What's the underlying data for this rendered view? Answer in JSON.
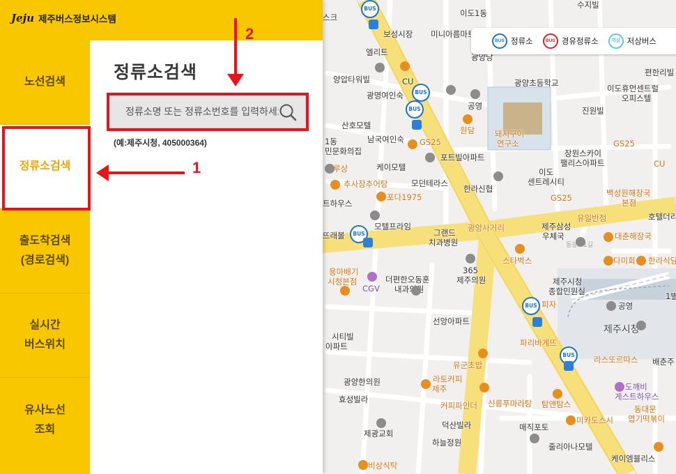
{
  "app": {
    "logo_mark": "Jeju",
    "title": "제주버스정보시스템"
  },
  "nav": {
    "items": [
      {
        "lines": [
          "노선검색"
        ]
      },
      {
        "lines": [
          "정류소검색"
        ]
      },
      {
        "lines": [
          "출도착검색",
          "(경로검색)"
        ]
      },
      {
        "lines": [
          "실시간",
          "버스위치"
        ]
      },
      {
        "lines": [
          "유사노선",
          "조회"
        ]
      }
    ]
  },
  "content": {
    "page_title": "정류소검색",
    "search_placeholder": "정류소명 또는 정류소번호를 입력하세요",
    "hint": "(예:제주시청, 405000364)"
  },
  "legend": {
    "stop": {
      "icon": "BUS",
      "label": "정류소"
    },
    "via_stop": {
      "icon": "BUS",
      "label": "경유정류소"
    },
    "lowfloor": {
      "icon": "저상",
      "label": "저상버스"
    }
  },
  "annotations": {
    "num_1": "1",
    "num_2": "2"
  },
  "map": {
    "bus_icon_text": "BUS",
    "labels": [
      {
        "id": "l1",
        "text": "이도1동",
        "cls": "big"
      },
      {
        "id": "l2",
        "text": "수지빌"
      },
      {
        "id": "l3",
        "text": "보성시장",
        "cls": "orange"
      },
      {
        "id": "l4",
        "text": "미니아름마트"
      },
      {
        "id": "l5",
        "text": "엘리트"
      },
      {
        "id": "l6",
        "text": "양압타워빌"
      },
      {
        "id": "l7",
        "text": "CU",
        "cls": "orange"
      },
      {
        "id": "l8",
        "text": "광명여인숙"
      },
      {
        "id": "l9",
        "text": "광양초등학교"
      },
      {
        "id": "l10",
        "text": "편한리빌"
      },
      {
        "id": "l11",
        "text": "이도휴먼센트럴"
      },
      {
        "id": "l12",
        "text": "오피스텔"
      },
      {
        "id": "l13",
        "text": "공영"
      },
      {
        "id": "l14",
        "text": "진원빌"
      },
      {
        "id": "l15",
        "text": "산호모텔"
      },
      {
        "id": "l16",
        "text": "원담",
        "cls": "orange"
      },
      {
        "id": "l17",
        "text": "돼지구이",
        "cls": "orange"
      },
      {
        "id": "l18",
        "text": "연구소",
        "cls": "orange"
      },
      {
        "id": "l19",
        "text": "남국여인숙"
      },
      {
        "id": "l20",
        "text": "GS25",
        "cls": "orange"
      },
      {
        "id": "l21",
        "text": "GS25",
        "cls": "orange"
      },
      {
        "id": "l22",
        "text": "CU",
        "cls": "orange"
      },
      {
        "id": "l23",
        "text": "1동"
      },
      {
        "id": "l24",
        "text": "민문화의집"
      },
      {
        "id": "l25",
        "text": "포트빌아파트"
      },
      {
        "id": "l26",
        "text": "장원스카이"
      },
      {
        "id": "l27",
        "text": "팰리스아파트"
      },
      {
        "id": "l28",
        "text": "루상",
        "cls": "orange"
      },
      {
        "id": "l29",
        "text": "케이모텔"
      },
      {
        "id": "l30",
        "text": "이도"
      },
      {
        "id": "l31",
        "text": "센트레시티"
      },
      {
        "id": "l32",
        "text": "추사장추어탕",
        "cls": "orange"
      },
      {
        "id": "l33",
        "text": "모던테라스"
      },
      {
        "id": "l34",
        "text": "한라신협"
      },
      {
        "id": "l35",
        "text": "백성원해장국",
        "cls": "orange"
      },
      {
        "id": "l36",
        "text": "본점",
        "cls": "orange"
      },
      {
        "id": "l37",
        "text": "포다1975",
        "cls": "orange"
      },
      {
        "id": "l38",
        "text": "GS25",
        "cls": "orange"
      },
      {
        "id": "l39",
        "text": "트하우스"
      },
      {
        "id": "l40",
        "text": "유일반점",
        "cls": "orange"
      },
      {
        "id": "l41",
        "text": "호텔더리"
      },
      {
        "id": "l42",
        "text": "모텔프라임"
      },
      {
        "id": "l43",
        "text": "광양사거리",
        "cls": "orange"
      },
      {
        "id": "l44",
        "text": "제주삼성"
      },
      {
        "id": "l45",
        "text": "우체국"
      },
      {
        "id": "l46",
        "text": "그랜드"
      },
      {
        "id": "l47",
        "text": "치과병원"
      },
      {
        "id": "l48",
        "text": "대춘해장국",
        "cls": "orange"
      },
      {
        "id": "l49",
        "text": "뜨래볼"
      },
      {
        "id": "l50",
        "text": "스타벅스",
        "cls": "orange"
      },
      {
        "id": "l51",
        "text": "다미회",
        "cls": "orange"
      },
      {
        "id": "l52",
        "text": "한라식당",
        "cls": "orange"
      },
      {
        "id": "l53",
        "text": "용마배기",
        "cls": "orange"
      },
      {
        "id": "l54",
        "text": "시청본점",
        "cls": "orange"
      },
      {
        "id": "l55",
        "text": "365"
      },
      {
        "id": "l56",
        "text": "제주의원"
      },
      {
        "id": "l57",
        "text": "더편한오동훈"
      },
      {
        "id": "l58",
        "text": "내과의원"
      },
      {
        "id": "l59",
        "text": "CGV",
        "cls": "purple"
      },
      {
        "id": "l60",
        "text": "제주시청"
      },
      {
        "id": "l61",
        "text": "종합민원실"
      },
      {
        "id": "l62",
        "text": "1별"
      },
      {
        "id": "l63",
        "text": "공영"
      },
      {
        "id": "l64",
        "text": "피자",
        "cls": "orange"
      },
      {
        "id": "l65",
        "text": "선앙아파트"
      },
      {
        "id": "l66",
        "text": "제주시청",
        "cls": "big"
      },
      {
        "id": "l67",
        "text": "시티빌"
      },
      {
        "id": "l68",
        "text": "아파트"
      },
      {
        "id": "l69",
        "text": "파리바게뜨",
        "cls": "orange"
      },
      {
        "id": "l70",
        "text": "라스또르따스",
        "cls": "orange"
      },
      {
        "id": "l71",
        "text": "배춘주"
      },
      {
        "id": "l72",
        "text": "유군초밥",
        "cls": "orange"
      },
      {
        "id": "l73",
        "text": "라토커피",
        "cls": "orange"
      },
      {
        "id": "l74",
        "text": "제주",
        "cls": "orange"
      },
      {
        "id": "l75",
        "text": "광양한의원"
      },
      {
        "id": "l76",
        "text": "도깨비",
        "cls": "purple"
      },
      {
        "id": "l77",
        "text": "게스트하우스",
        "cls": "purple"
      },
      {
        "id": "l78",
        "text": "효성빌라"
      },
      {
        "id": "l79",
        "text": "커피파인더",
        "cls": "orange"
      },
      {
        "id": "l80",
        "text": "신릉푸마라탕",
        "cls": "orange"
      },
      {
        "id": "l81",
        "text": "탐앤탐스",
        "cls": "orange"
      },
      {
        "id": "l82",
        "text": "동대문",
        "cls": "orange"
      },
      {
        "id": "l83",
        "text": "엽기떡볶이",
        "cls": "orange"
      },
      {
        "id": "l84",
        "text": "덕산빌라"
      },
      {
        "id": "l85",
        "text": "미카도스시",
        "cls": "orange"
      },
      {
        "id": "l86",
        "text": "제광교회"
      },
      {
        "id": "l87",
        "text": "매직포토"
      },
      {
        "id": "l88",
        "text": "하늘정원"
      },
      {
        "id": "l89",
        "text": "줄리아나모텔"
      },
      {
        "id": "l90",
        "text": "비상식탁",
        "cls": "orange"
      },
      {
        "id": "l91",
        "text": "케이엠블리스"
      },
      {
        "id": "l92",
        "text": "광양당"
      },
      {
        "id": "l93",
        "text": "동광로1길"
      },
      {
        "id": "l94",
        "text": "스크"
      }
    ]
  }
}
